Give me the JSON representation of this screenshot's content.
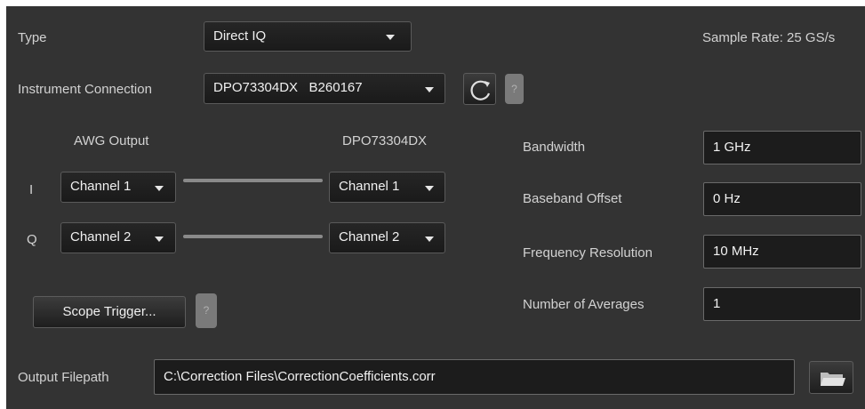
{
  "type": {
    "label": "Type",
    "value": "Direct IQ"
  },
  "sample_rate": {
    "text": "Sample Rate:  25 GS/s"
  },
  "instrument": {
    "label": "Instrument Connection",
    "value": "DPO73304DX   B260167",
    "help_text": "?"
  },
  "mapping": {
    "awg_header": "AWG Output",
    "scope_header": "DPO73304DX",
    "rows": [
      {
        "label": "I",
        "awg_channel": "Channel 1",
        "scope_channel": "Channel 1"
      },
      {
        "label": "Q",
        "awg_channel": "Channel 2",
        "scope_channel": "Channel 2"
      }
    ]
  },
  "scope_trigger": {
    "label": "Scope Trigger...",
    "help_text": "?"
  },
  "params": {
    "bandwidth": {
      "label": "Bandwidth",
      "value": "1 GHz"
    },
    "baseband_offset": {
      "label": "Baseband Offset",
      "value": "0 Hz"
    },
    "freq_resolution": {
      "label": "Frequency Resolution",
      "value": "10 MHz"
    },
    "averages": {
      "label": "Number of Averages",
      "value": "1"
    }
  },
  "output": {
    "label": "Output Filepath",
    "value": "C:\\Correction Files\\CorrectionCoefficients.corr"
  },
  "icons": {
    "refresh": "refresh-icon",
    "folder": "folder-icon",
    "dropdown": "chevron-down-icon"
  }
}
